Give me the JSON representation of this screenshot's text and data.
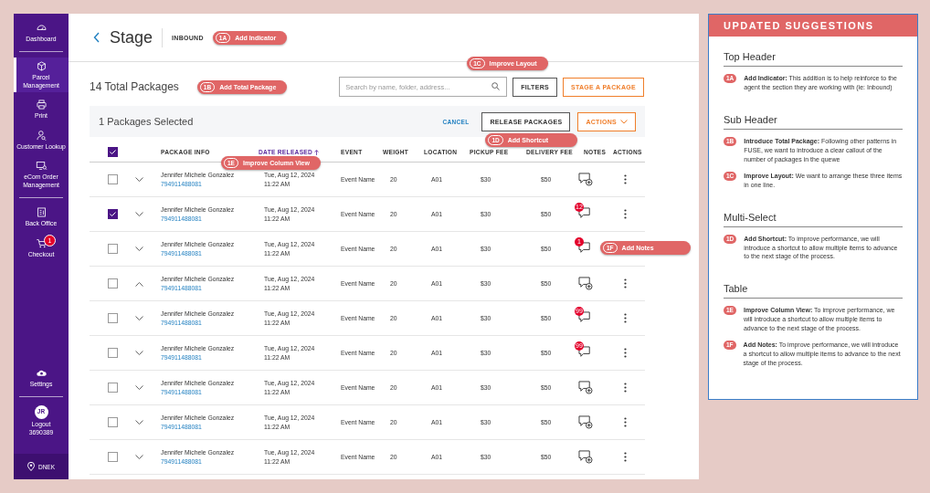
{
  "sidebar": {
    "groups": [
      [
        {
          "label": "Dashboard",
          "selected": false
        }
      ],
      [
        {
          "label": "Parcel Management",
          "selected": true
        },
        {
          "label": "Print",
          "selected": false
        },
        {
          "label": "Customer Lookup",
          "selected": false
        },
        {
          "label": "eCom Order Management",
          "selected": false
        }
      ],
      [
        {
          "label": "Back Office",
          "selected": false
        },
        {
          "label": "Checkout",
          "selected": false,
          "badge": "1"
        }
      ]
    ],
    "settings": {
      "label": "Settings"
    },
    "user": {
      "initials": "JR",
      "label": "Logout",
      "id": "3690389"
    },
    "location": "DNEK"
  },
  "header": {
    "title": "Stage",
    "indicator": "INBOUND",
    "annotation": {
      "code": "1A",
      "label": "Add Indicator"
    }
  },
  "subheader": {
    "total": "14 Total Packages",
    "annotation": {
      "code": "1B",
      "label": "Add Total Package"
    },
    "search": {
      "placeholder": "Search by name, folder, address..."
    },
    "filters": "FILTERS",
    "stage": "STAGE A PACKAGE",
    "layout_annotation": {
      "code": "1C",
      "label": "Improve Layout"
    }
  },
  "selection_bar": {
    "count": "1 Packages Selected",
    "cancel": "CANCEL",
    "release": "RELEASE PACKAGES",
    "actions": "ACTIONS",
    "annotation": {
      "code": "1D",
      "label": "Add Shortcut"
    }
  },
  "table": {
    "all_checked": true,
    "columns": [
      {
        "label": "PACKAGE INFO",
        "sorted": false
      },
      {
        "label": "DATE RELEASED",
        "sorted": true
      },
      {
        "label": "EVENT",
        "sorted": false
      },
      {
        "label": "WEIGHT",
        "sorted": false
      },
      {
        "label": "LOCATION",
        "sorted": false
      },
      {
        "label": "PICKUP FEE",
        "sorted": false
      },
      {
        "label": "DELIVERY FEE",
        "sorted": false
      },
      {
        "label": "NOTES",
        "sorted": false
      },
      {
        "label": "ACTIONS",
        "sorted": false
      }
    ],
    "annotation": {
      "code": "1E",
      "label": "Improve Column View"
    },
    "rows": [
      {
        "checked": false,
        "expanded": false,
        "name": "Jennifer Michele Gonzalez",
        "tracking": "794911488081",
        "date": "Tue, Aug 12, 2024",
        "time": "11:22 AM",
        "event": "Event Name",
        "weight": "20",
        "location": "A01",
        "pickup_fee": "$30",
        "delivery_fee": "$50",
        "notes": {
          "kind": "add"
        }
      },
      {
        "checked": true,
        "expanded": false,
        "name": "Jennifer Michele Gonzalez",
        "tracking": "794911488081",
        "date": "Tue, Aug 12, 2024",
        "time": "11:22 AM",
        "event": "Event Name",
        "weight": "20",
        "location": "A01",
        "pickup_fee": "$30",
        "delivery_fee": "$50",
        "notes": {
          "kind": "count",
          "count": "12"
        }
      },
      {
        "checked": false,
        "expanded": false,
        "name": "Jennifer Michele Gonzalez",
        "tracking": "794911488081",
        "date": "Tue, Aug 12, 2024",
        "time": "11:22 AM",
        "event": "Event Name",
        "weight": "20",
        "location": "A01",
        "pickup_fee": "$30",
        "delivery_fee": "$50",
        "notes": {
          "kind": "count",
          "count": "1"
        },
        "annotation": {
          "code": "1F",
          "label": "Add Notes"
        }
      },
      {
        "checked": false,
        "expanded": true,
        "name": "Jennifer Michele Gonzalez",
        "tracking": "794911488081",
        "date": "Tue, Aug 12, 2024",
        "time": "11:22 AM",
        "event": "Event Name",
        "weight": "20",
        "location": "A01",
        "pickup_fee": "$30",
        "delivery_fee": "$50",
        "notes": {
          "kind": "add"
        }
      },
      {
        "checked": false,
        "expanded": false,
        "name": "Jennifer Michele Gonzalez",
        "tracking": "794911488081",
        "date": "Tue, Aug 12, 2024",
        "time": "11:22 AM",
        "event": "Event Name",
        "weight": "20",
        "location": "A01",
        "pickup_fee": "$30",
        "delivery_fee": "$50",
        "notes": {
          "kind": "count",
          "count": "99"
        }
      },
      {
        "checked": false,
        "expanded": false,
        "name": "Jennifer Michele Gonzalez",
        "tracking": "794911488081",
        "date": "Tue, Aug 12, 2024",
        "time": "11:22 AM",
        "event": "Event Name",
        "weight": "20",
        "location": "A01",
        "pickup_fee": "$30",
        "delivery_fee": "$50",
        "notes": {
          "kind": "count",
          "count": "99"
        }
      },
      {
        "checked": false,
        "expanded": false,
        "name": "Jennifer Michele Gonzalez",
        "tracking": "794911488081",
        "date": "Tue, Aug 12, 2024",
        "time": "11:22 AM",
        "event": "Event Name",
        "weight": "20",
        "location": "A01",
        "pickup_fee": "$30",
        "delivery_fee": "$50",
        "notes": {
          "kind": "add"
        }
      },
      {
        "checked": false,
        "expanded": false,
        "name": "Jennifer Michele Gonzalez",
        "tracking": "794911488081",
        "date": "Tue, Aug 12, 2024",
        "time": "11:22 AM",
        "event": "Event Name",
        "weight": "20",
        "location": "A01",
        "pickup_fee": "$30",
        "delivery_fee": "$50",
        "notes": {
          "kind": "add"
        }
      },
      {
        "checked": false,
        "expanded": false,
        "name": "Jennifer Michele Gonzalez",
        "tracking": "794911488081",
        "date": "Tue, Aug 12, 2024",
        "time": "11:22 AM",
        "event": "Event Name",
        "weight": "20",
        "location": "A01",
        "pickup_fee": "$30",
        "delivery_fee": "$50",
        "notes": {
          "kind": "add"
        }
      }
    ]
  },
  "suggestions": {
    "title": "UPDATED SUGGESTIONS",
    "sections": [
      {
        "heading": "Top Header",
        "items": [
          {
            "code": "1A",
            "text": "**Add Indicator:** This addition is to help reinforce to the agent the section they are working with (ie: Inbound)"
          }
        ]
      },
      {
        "heading": "Sub Header",
        "items": [
          {
            "code": "1B",
            "text": "**Introduce Total Package:** Following  other patterns in FUSE,  we want to introduce a clear callout of the number of packages in the quewe"
          },
          {
            "code": "1C",
            "text": "**Improve Layout:** We want to arrange these three items in one line."
          }
        ]
      },
      {
        "heading": "Multi-Select",
        "items": [
          {
            "code": "1D",
            "text": "**Add Shortcut:** To improve performance, we will introduce a shortcut to allow multiple items to advance to the next stage of the process."
          }
        ]
      },
      {
        "heading": "Table",
        "items": [
          {
            "code": "1E",
            "text": "**Improve Column View:** To improve performance, we will introduce a shortcut to allow multiple items to advance to the next stage of the process."
          },
          {
            "code": "1F",
            "text": "**Add Notes:** To improve performance, we will introduce a shortcut to allow multiple items to advance to the next stage of the process."
          }
        ]
      }
    ]
  }
}
